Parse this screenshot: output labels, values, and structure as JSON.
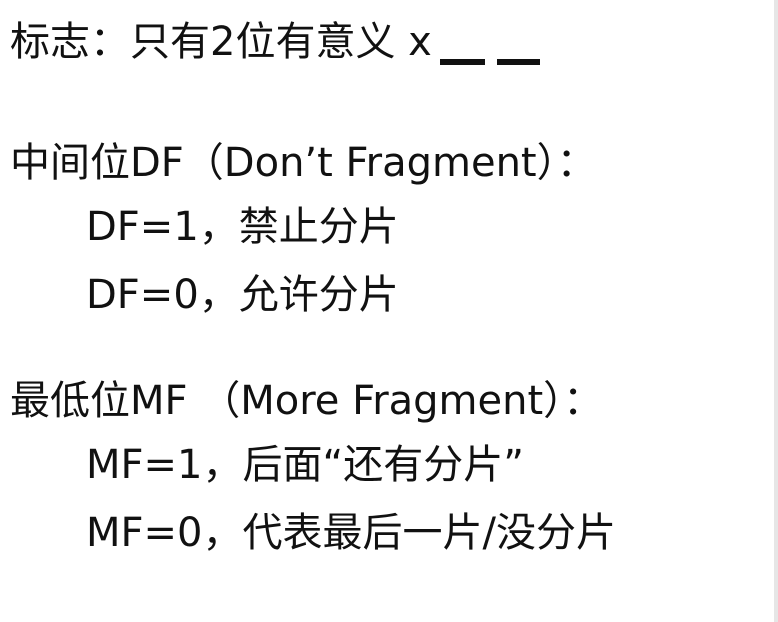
{
  "flags": {
    "heading": "标志：只有2位有意义 x"
  },
  "df": {
    "title": "中间位DF（Don’t Fragment）：",
    "line1": "DF=1，禁止分片",
    "line2": "DF=0，允许分片"
  },
  "mf": {
    "title": "最低位MF （More Fragment）：",
    "line1": "MF=1，后面“还有分片”",
    "line2": "MF=0，代表最后一片/没分片"
  }
}
